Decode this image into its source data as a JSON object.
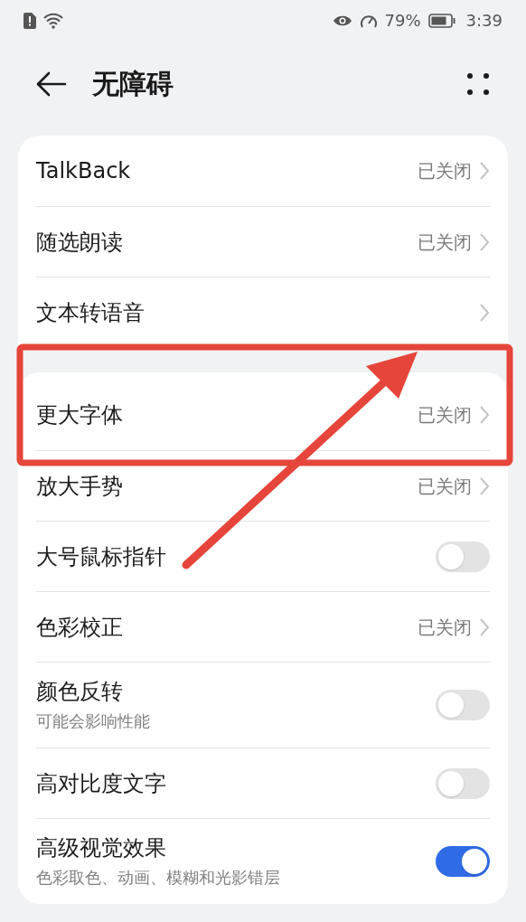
{
  "status_bar": {
    "battery": "79%",
    "time": "3:39"
  },
  "header": {
    "title": "无障碍"
  },
  "sections": [
    {
      "items": [
        {
          "kind": "link",
          "label": "TalkBack",
          "value": "已关闭"
        },
        {
          "kind": "link",
          "label": "随选朗读",
          "value": "已关闭"
        },
        {
          "kind": "link",
          "label": "文本转语音"
        }
      ]
    },
    {
      "items": [
        {
          "kind": "link",
          "label": "更大字体",
          "value": "已关闭"
        },
        {
          "kind": "link",
          "label": "放大手势",
          "value": "已关闭"
        },
        {
          "kind": "toggle",
          "label": "大号鼠标指针",
          "on": false
        },
        {
          "kind": "link",
          "label": "色彩校正",
          "value": "已关闭"
        },
        {
          "kind": "toggle",
          "label": "颜色反转",
          "subtitle": "可能会影响性能",
          "on": false
        },
        {
          "kind": "toggle",
          "label": "高对比度文字",
          "on": false
        },
        {
          "kind": "toggle",
          "label": "高级视觉效果",
          "subtitle": "色彩取色、动画、模糊和光影错层",
          "on": true
        }
      ]
    }
  ]
}
